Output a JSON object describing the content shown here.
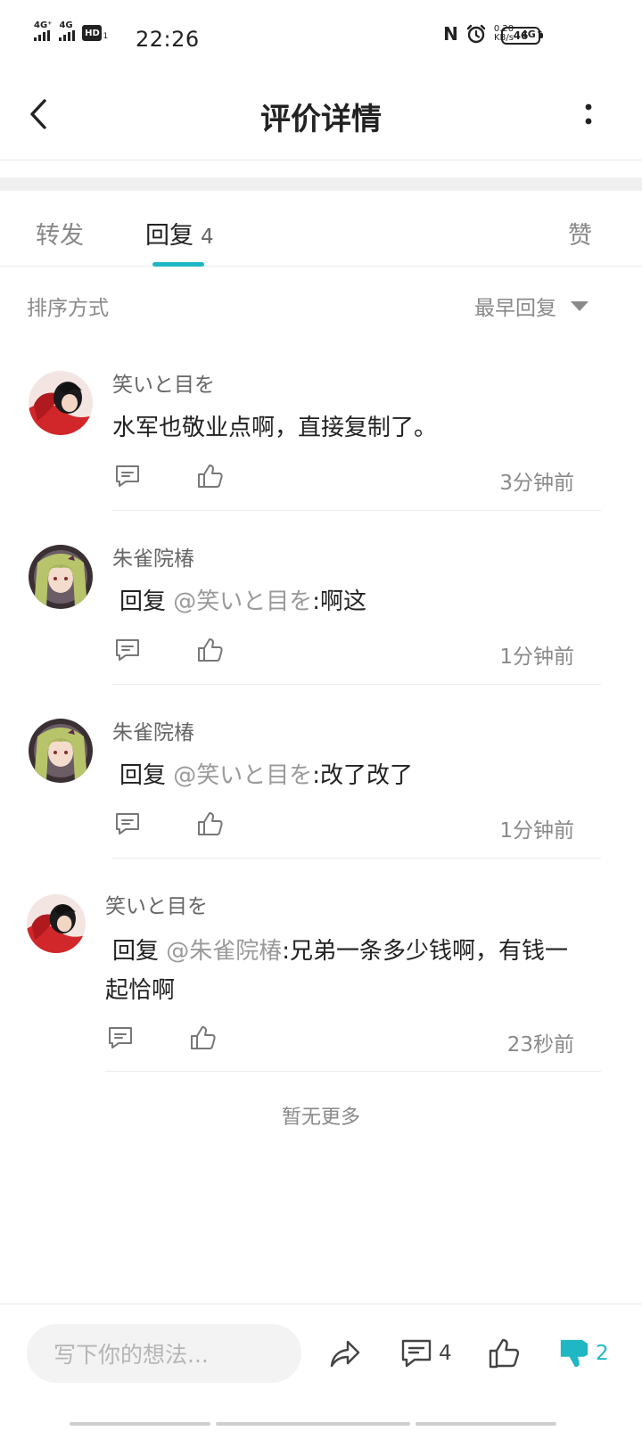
{
  "status": {
    "sig1": "4G⁺",
    "sig2": "4G",
    "hd": "HD",
    "hd_sub": "1",
    "time": "22:26",
    "nfc": "N",
    "speed_value": "0.20",
    "speed_unit": "KB/s",
    "net": "4G↑",
    "battery": "46"
  },
  "header": {
    "title": "评价详情"
  },
  "tabs": {
    "forward": "转发",
    "reply": "回复",
    "reply_count": "4",
    "like": "赞"
  },
  "sort": {
    "label": "排序方式",
    "value": "最早回复"
  },
  "comments": [
    {
      "user": "笑いと目を",
      "prefix": "",
      "mention": "",
      "text": "水军也敬业点啊，直接复制了。",
      "time": "3分钟前"
    },
    {
      "user": "朱雀院椿",
      "prefix": "回复 ",
      "mention": "@笑いと目を",
      "text": ":啊这",
      "time": "1分钟前"
    },
    {
      "user": "朱雀院椿",
      "prefix": "回复 ",
      "mention": "@笑いと目を",
      "text": ":改了改了",
      "time": "1分钟前"
    },
    {
      "user": "笑いと目を",
      "prefix": "回复 ",
      "mention": "@朱雀院椿",
      "text": ":兄弟一条多少钱啊，有钱一",
      "text2": "起恰啊",
      "time": "23秒前"
    }
  ],
  "no_more": "暂无更多",
  "bottom": {
    "placeholder": "写下你的想法...",
    "comment_count": "4",
    "dislike_count": "2"
  },
  "colors": {
    "accent": "#1fb7c4"
  }
}
